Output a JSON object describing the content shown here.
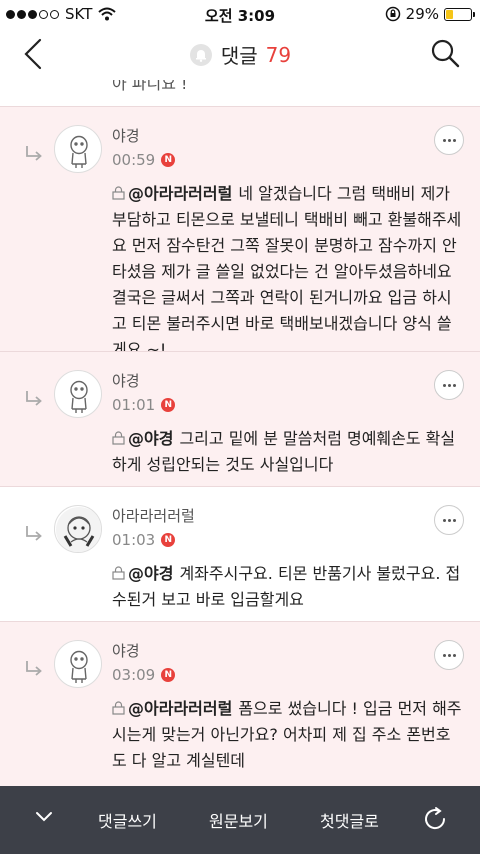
{
  "status_bar": {
    "carrier": "SKT",
    "time": "오전 3:09",
    "battery_text": "29%",
    "battery_level": 0.29,
    "battery_color": "#f5c518"
  },
  "nav": {
    "title": "댓글",
    "count": "79"
  },
  "partial_text": "아 파니요 !",
  "comments": [
    {
      "author": "야경",
      "time": "00:59",
      "badge": "N",
      "mention": "@아라라러러럴",
      "text": "네 알겠습니다 그럼 택배비 제가 부담하고 티몬으로 보낼테니 택배비 빼고 환불해주세요 먼저 잠수탄건 그쪽 잘못이 분명하고 잠수까지 안타셨음 제가 글 쓸일 없었다는 건 알아두셨음하네요 결국은 글써서 그쪽과 연락이 된거니까요 입금 하시고 티몬 불러주시면 바로 택배보내겠습니다 양식 쓸게요 ~!"
    },
    {
      "author": "야경",
      "time": "01:01",
      "badge": "N",
      "mention": "@야경",
      "text": "그리고 밑에 분 말씀처럼 명예훼손도 확실하게 성립안되는 것도 사실입니다"
    },
    {
      "author": "아라라러러럴",
      "time": "01:03",
      "badge": "N",
      "mention": "@야경",
      "text": "계좌주시구요. 티몬 반품기사 불렀구요. 접수된거 보고 바로 입금할게요"
    },
    {
      "author": "야경",
      "time": "03:09",
      "badge": "N",
      "mention": "@아라라러러럴",
      "text": "폼으로 썼습니다 ! 입금 먼저 해주시는게 맞는거 아닌가요? 어차피 제 집 주소 폰번호도 다 알고 계실텐데"
    }
  ],
  "bottom_bar": {
    "write": "댓글쓰기",
    "original": "원문보기",
    "first": "첫댓글로"
  },
  "colors": {
    "accent": "#e8413c",
    "comment_bg": "#fdf0f1",
    "bottom_bar": "#3d4048"
  },
  "icons": [
    "signal-dots-icon",
    "wifi-icon",
    "battery-icon",
    "back-chevron-icon",
    "bell-icon",
    "search-icon",
    "reply-arrow-icon",
    "lock-icon",
    "more-icon",
    "chevron-down-icon",
    "refresh-icon"
  ]
}
